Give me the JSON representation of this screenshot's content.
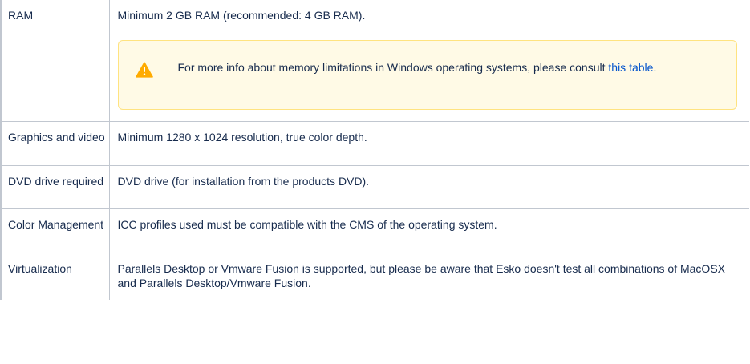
{
  "rows": [
    {
      "label": "RAM",
      "value": "Minimum 2 GB RAM (recommended: 4 GB RAM).",
      "warning": {
        "icon": "warning-icon",
        "text_before": "For more info about memory limitations in Windows operating systems, please consult ",
        "link_text": "this table",
        "text_after": "."
      }
    },
    {
      "label": "Graphics and video",
      "value": "Minimum 1280 x 1024 resolution, true color depth."
    },
    {
      "label": "DVD drive required",
      "value": "DVD drive (for installation from the products DVD)."
    },
    {
      "label": "Color Management",
      "value": "ICC profiles used must be compatible with the CMS of the operating system."
    },
    {
      "label": "Virtualization",
      "value": "Parallels Desktop or Vmware Fusion is supported, but please be aware that Esko doesn't test all combinations of MacOSX and Parallels Desktop/Vmware Fusion."
    }
  ],
  "colors": {
    "border": "#c1c7d0",
    "warning_bg": "#fffae6",
    "warning_border": "#ffe380",
    "warning_icon": "#ffab00",
    "link": "#0052cc",
    "text": "#172b4d"
  }
}
